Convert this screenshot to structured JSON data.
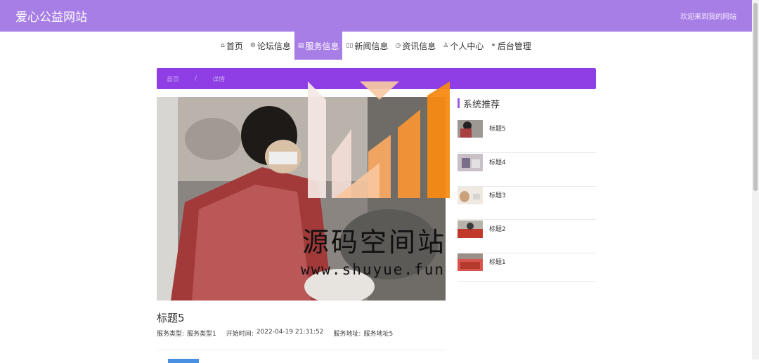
{
  "header": {
    "site_title": "爱心公益网站",
    "welcome": "欢迎来到我的网站"
  },
  "nav": [
    {
      "label": "首页",
      "icon": "home-icon"
    },
    {
      "label": "论坛信息",
      "icon": "forum-icon"
    },
    {
      "label": "服务信息",
      "icon": "service-icon",
      "active": true
    },
    {
      "label": "新闻信息",
      "icon": "news-icon"
    },
    {
      "label": "资讯信息",
      "icon": "info-icon"
    },
    {
      "label": "个人中心",
      "icon": "user-icon"
    },
    {
      "label": "后台管理",
      "icon": "link-icon"
    }
  ],
  "breadcrumb": {
    "home": "首页",
    "separator": "/",
    "current": "详情"
  },
  "detail": {
    "title": "标题5",
    "service_type_label": "服务类型:",
    "service_type_value": "服务类型1",
    "start_time_label": "开始时间:",
    "start_time_value": "2022-04-19 21:31:52",
    "address_label": "服务地址:",
    "address_value": "服务地址5"
  },
  "sidebar": {
    "title": "系统推荐",
    "items": [
      {
        "label": "标题5"
      },
      {
        "label": "标题4"
      },
      {
        "label": "标题3"
      },
      {
        "label": "标题2"
      },
      {
        "label": "标题1"
      }
    ]
  },
  "watermark": {
    "text": "源码空间站",
    "url": "www.shuyue.fun"
  },
  "colors": {
    "header": "#a77de6",
    "breadcrumb": "#8f3ee6",
    "accent": "#9b59e6"
  }
}
